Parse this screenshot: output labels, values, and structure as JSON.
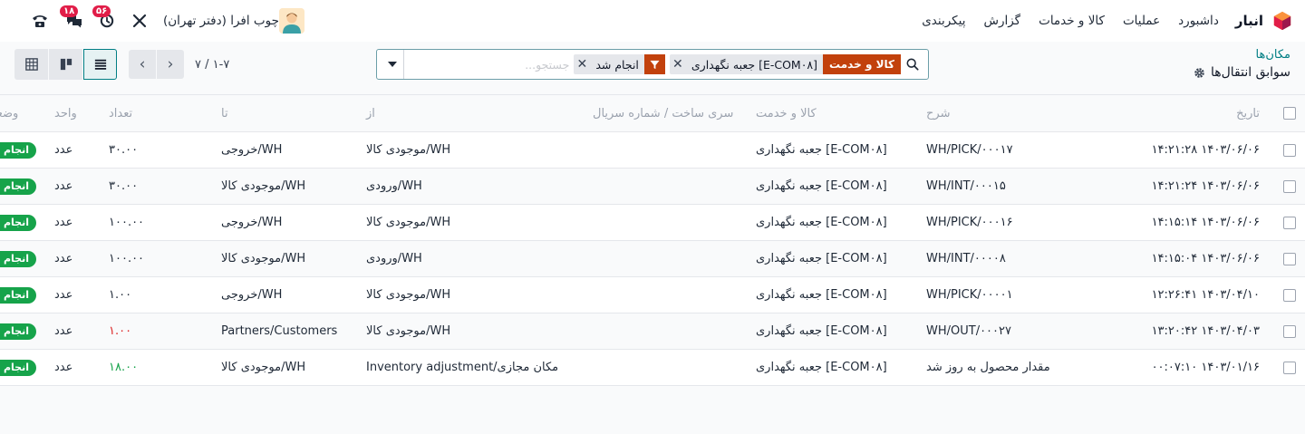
{
  "nav": {
    "app_name": "انبار",
    "menu": [
      "داشبورد",
      "عملیات",
      "کالا و خدمات",
      "گزارش",
      "پیکربندی"
    ],
    "company": "چوب افرا (دفتر تهران)",
    "activity_badge": "۵۶",
    "messages_badge": "۱۸"
  },
  "breadcrumb": {
    "parent": "مکان‌ها",
    "current": "سوابق انتقال‌ها"
  },
  "search": {
    "facet1_label": "کالا و خدمت",
    "facet1_value": "[E-COM۰۸] جعبه نگهداری",
    "facet2_value": "انجام شد",
    "placeholder": "جستجو..."
  },
  "pager": {
    "value": "۱-۷ / ۷"
  },
  "colors": {
    "brand": "#017e84",
    "facet": "#c2410c",
    "done": "#16a34a",
    "negative": "#dc2626"
  },
  "columns": [
    "تاریخ",
    "شرح",
    "کالا و خدمت",
    "سری ساخت / شماره سریال",
    "از",
    "تا",
    "تعداد",
    "واحد",
    "وضعیت"
  ],
  "rows": [
    {
      "date": "۱۴۰۳/۰۶/۰۶ ۱۴:۲۱:۲۸",
      "ref": "WH/PICK/۰۰۰۱۷",
      "product": "[E-COM۰۸] جعبه نگهداری",
      "lot": "",
      "from": "WH/موجودی کالا",
      "to": "WH/خروجی",
      "qty": "۳۰.۰۰",
      "uom": "عدد",
      "status": "انجام شد"
    },
    {
      "date": "۱۴۰۳/۰۶/۰۶ ۱۴:۲۱:۲۴",
      "ref": "WH/INT/۰۰۰۱۵",
      "product": "[E-COM۰۸] جعبه نگهداری",
      "lot": "",
      "from": "WH/ورودی",
      "to": "WH/موجودی کالا",
      "qty": "۳۰.۰۰",
      "uom": "عدد",
      "status": "انجام شد"
    },
    {
      "date": "۱۴۰۳/۰۶/۰۶ ۱۴:۱۵:۱۴",
      "ref": "WH/PICK/۰۰۰۱۶",
      "product": "[E-COM۰۸] جعبه نگهداری",
      "lot": "",
      "from": "WH/موجودی کالا",
      "to": "WH/خروجی",
      "qty": "۱۰۰.۰۰",
      "uom": "عدد",
      "status": "انجام شد"
    },
    {
      "date": "۱۴۰۳/۰۶/۰۶ ۱۴:۱۵:۰۴",
      "ref": "WH/INT/۰۰۰۰۸",
      "product": "[E-COM۰۸] جعبه نگهداری",
      "lot": "",
      "from": "WH/ورودی",
      "to": "WH/موجودی کالا",
      "qty": "۱۰۰.۰۰",
      "uom": "عدد",
      "status": "انجام شد"
    },
    {
      "date": "۱۴۰۳/۰۴/۱۰ ۱۲:۲۶:۴۱",
      "ref": "WH/PICK/۰۰۰۰۱",
      "product": "[E-COM۰۸] جعبه نگهداری",
      "lot": "",
      "from": "WH/موجودی کالا",
      "to": "WH/خروجی",
      "qty": "۱.۰۰",
      "uom": "عدد",
      "status": "انجام شد"
    },
    {
      "date": "۱۴۰۳/۰۴/۰۳ ۱۳:۲۰:۴۲",
      "ref": "WH/OUT/۰۰۰۲۷",
      "product": "[E-COM۰۸] جعبه نگهداری",
      "lot": "",
      "from": "WH/موجودی کالا",
      "to": "Partners/Customers",
      "qty": "۱.۰۰",
      "uom": "عدد",
      "status": "انجام شد",
      "qty_class": "neg"
    },
    {
      "date": "۱۴۰۳/۰۱/۱۶ ۰۰:۰۷:۱۰",
      "ref": "مقدار محصول به روز شد",
      "product": "[E-COM۰۸] جعبه نگهداری",
      "lot": "",
      "from": "مکان مجازی/Inventory adjustment",
      "to": "WH/موجودی کالا",
      "qty": "۱۸.۰۰",
      "uom": "عدد",
      "status": "انجام شد",
      "qty_class": "pos"
    }
  ]
}
